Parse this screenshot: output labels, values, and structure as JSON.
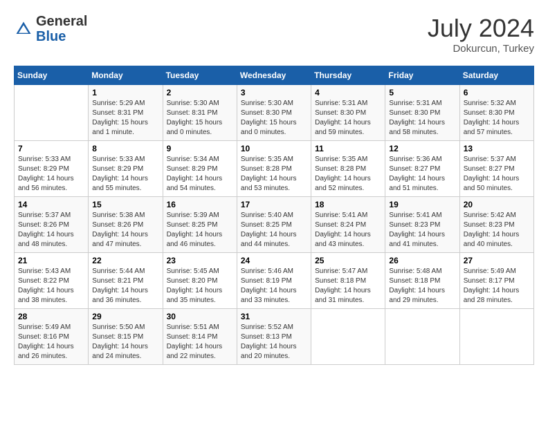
{
  "header": {
    "logo_general": "General",
    "logo_blue": "Blue",
    "title": "July 2024",
    "location": "Dokurcun, Turkey"
  },
  "calendar": {
    "days_of_week": [
      "Sunday",
      "Monday",
      "Tuesday",
      "Wednesday",
      "Thursday",
      "Friday",
      "Saturday"
    ],
    "weeks": [
      [
        {
          "day": "",
          "content": ""
        },
        {
          "day": "1",
          "content": "Sunrise: 5:29 AM\nSunset: 8:31 PM\nDaylight: 15 hours\nand 1 minute."
        },
        {
          "day": "2",
          "content": "Sunrise: 5:30 AM\nSunset: 8:31 PM\nDaylight: 15 hours\nand 0 minutes."
        },
        {
          "day": "3",
          "content": "Sunrise: 5:30 AM\nSunset: 8:30 PM\nDaylight: 15 hours\nand 0 minutes."
        },
        {
          "day": "4",
          "content": "Sunrise: 5:31 AM\nSunset: 8:30 PM\nDaylight: 14 hours\nand 59 minutes."
        },
        {
          "day": "5",
          "content": "Sunrise: 5:31 AM\nSunset: 8:30 PM\nDaylight: 14 hours\nand 58 minutes."
        },
        {
          "day": "6",
          "content": "Sunrise: 5:32 AM\nSunset: 8:30 PM\nDaylight: 14 hours\nand 57 minutes."
        }
      ],
      [
        {
          "day": "7",
          "content": "Sunrise: 5:33 AM\nSunset: 8:29 PM\nDaylight: 14 hours\nand 56 minutes."
        },
        {
          "day": "8",
          "content": "Sunrise: 5:33 AM\nSunset: 8:29 PM\nDaylight: 14 hours\nand 55 minutes."
        },
        {
          "day": "9",
          "content": "Sunrise: 5:34 AM\nSunset: 8:29 PM\nDaylight: 14 hours\nand 54 minutes."
        },
        {
          "day": "10",
          "content": "Sunrise: 5:35 AM\nSunset: 8:28 PM\nDaylight: 14 hours\nand 53 minutes."
        },
        {
          "day": "11",
          "content": "Sunrise: 5:35 AM\nSunset: 8:28 PM\nDaylight: 14 hours\nand 52 minutes."
        },
        {
          "day": "12",
          "content": "Sunrise: 5:36 AM\nSunset: 8:27 PM\nDaylight: 14 hours\nand 51 minutes."
        },
        {
          "day": "13",
          "content": "Sunrise: 5:37 AM\nSunset: 8:27 PM\nDaylight: 14 hours\nand 50 minutes."
        }
      ],
      [
        {
          "day": "14",
          "content": "Sunrise: 5:37 AM\nSunset: 8:26 PM\nDaylight: 14 hours\nand 48 minutes."
        },
        {
          "day": "15",
          "content": "Sunrise: 5:38 AM\nSunset: 8:26 PM\nDaylight: 14 hours\nand 47 minutes."
        },
        {
          "day": "16",
          "content": "Sunrise: 5:39 AM\nSunset: 8:25 PM\nDaylight: 14 hours\nand 46 minutes."
        },
        {
          "day": "17",
          "content": "Sunrise: 5:40 AM\nSunset: 8:25 PM\nDaylight: 14 hours\nand 44 minutes."
        },
        {
          "day": "18",
          "content": "Sunrise: 5:41 AM\nSunset: 8:24 PM\nDaylight: 14 hours\nand 43 minutes."
        },
        {
          "day": "19",
          "content": "Sunrise: 5:41 AM\nSunset: 8:23 PM\nDaylight: 14 hours\nand 41 minutes."
        },
        {
          "day": "20",
          "content": "Sunrise: 5:42 AM\nSunset: 8:23 PM\nDaylight: 14 hours\nand 40 minutes."
        }
      ],
      [
        {
          "day": "21",
          "content": "Sunrise: 5:43 AM\nSunset: 8:22 PM\nDaylight: 14 hours\nand 38 minutes."
        },
        {
          "day": "22",
          "content": "Sunrise: 5:44 AM\nSunset: 8:21 PM\nDaylight: 14 hours\nand 36 minutes."
        },
        {
          "day": "23",
          "content": "Sunrise: 5:45 AM\nSunset: 8:20 PM\nDaylight: 14 hours\nand 35 minutes."
        },
        {
          "day": "24",
          "content": "Sunrise: 5:46 AM\nSunset: 8:19 PM\nDaylight: 14 hours\nand 33 minutes."
        },
        {
          "day": "25",
          "content": "Sunrise: 5:47 AM\nSunset: 8:18 PM\nDaylight: 14 hours\nand 31 minutes."
        },
        {
          "day": "26",
          "content": "Sunrise: 5:48 AM\nSunset: 8:18 PM\nDaylight: 14 hours\nand 29 minutes."
        },
        {
          "day": "27",
          "content": "Sunrise: 5:49 AM\nSunset: 8:17 PM\nDaylight: 14 hours\nand 28 minutes."
        }
      ],
      [
        {
          "day": "28",
          "content": "Sunrise: 5:49 AM\nSunset: 8:16 PM\nDaylight: 14 hours\nand 26 minutes."
        },
        {
          "day": "29",
          "content": "Sunrise: 5:50 AM\nSunset: 8:15 PM\nDaylight: 14 hours\nand 24 minutes."
        },
        {
          "day": "30",
          "content": "Sunrise: 5:51 AM\nSunset: 8:14 PM\nDaylight: 14 hours\nand 22 minutes."
        },
        {
          "day": "31",
          "content": "Sunrise: 5:52 AM\nSunset: 8:13 PM\nDaylight: 14 hours\nand 20 minutes."
        },
        {
          "day": "",
          "content": ""
        },
        {
          "day": "",
          "content": ""
        },
        {
          "day": "",
          "content": ""
        }
      ]
    ]
  }
}
